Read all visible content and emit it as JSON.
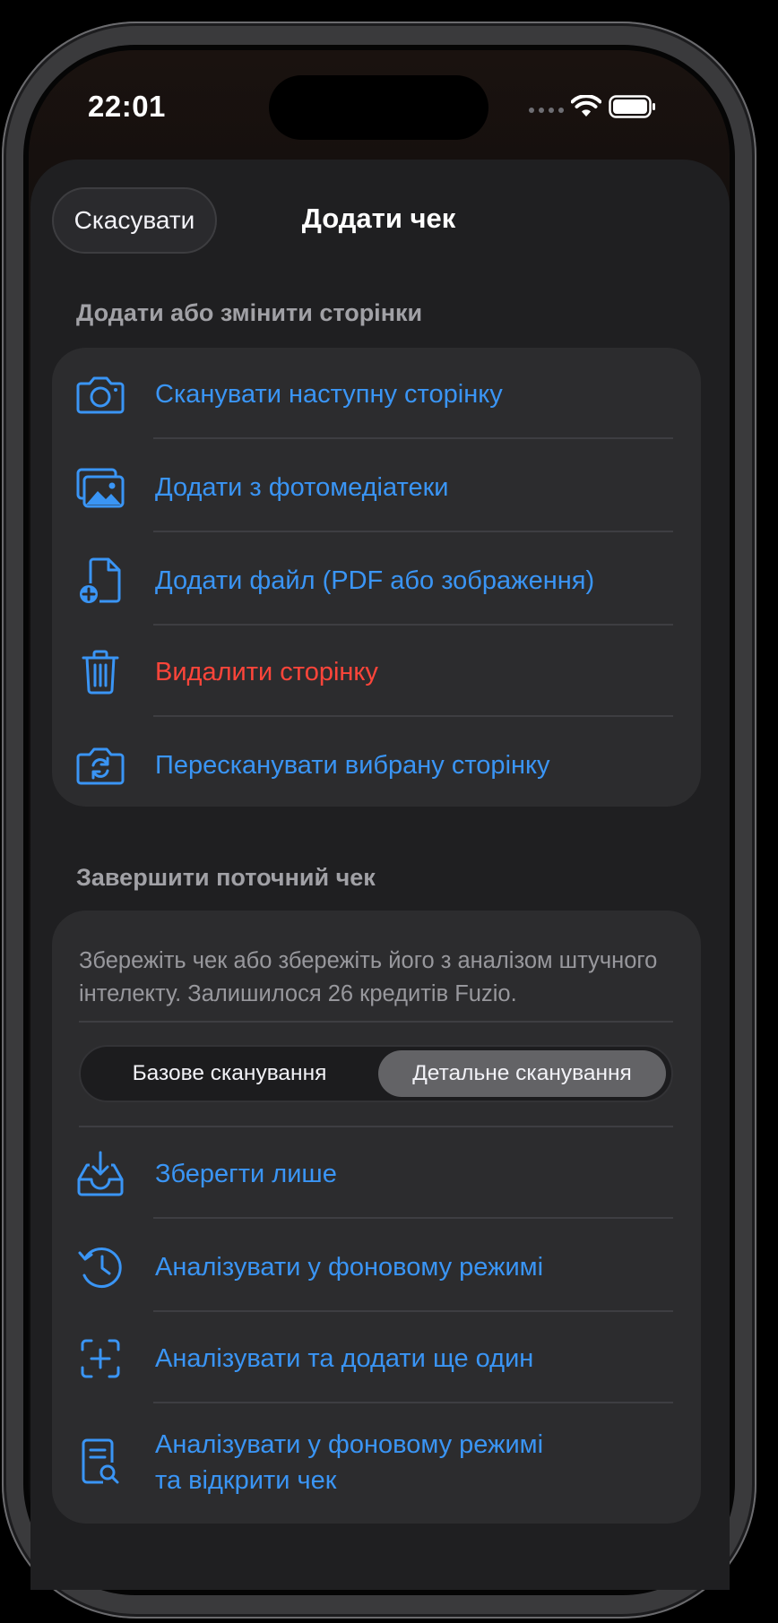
{
  "status_bar": {
    "time": "22:01"
  },
  "header": {
    "cancel_label": "Скасувати",
    "title": "Додати чек"
  },
  "pages_section": {
    "header": "Додати або змінити сторінки",
    "items": [
      {
        "label": "Сканувати наступну сторінку",
        "icon": "camera-icon"
      },
      {
        "label": "Додати з фотомедіатеки",
        "icon": "photo-library-icon"
      },
      {
        "label": "Додати файл (PDF або зображення)",
        "icon": "add-file-icon"
      },
      {
        "label": "Видалити сторінку",
        "icon": "trash-icon"
      },
      {
        "label": "Пересканувати вибрану сторінку",
        "icon": "camera-rotate-icon"
      }
    ]
  },
  "finish_section": {
    "header": "Завершити поточний чек",
    "description": "Збережіть чек або збережіть його з аналізом штучного інтелекту. Залишилося 26 кредитів Fuzio.",
    "segmented": {
      "options": [
        "Базове сканування",
        "Детальне сканування"
      ],
      "selected": "Детальне сканування"
    },
    "items": [
      {
        "label": "Зберегти лише",
        "icon": "tray-download-icon"
      },
      {
        "label": "Аналізувати у фоновому режимі",
        "icon": "clock-history-icon"
      },
      {
        "label": "Аналізувати та додати ще один",
        "icon": "scan-plus-icon"
      },
      {
        "label_line1": "Аналізувати у фоновому режимі",
        "label_line2": "та відкрити чек",
        "icon": "doc-search-icon"
      }
    ]
  },
  "colors": {
    "accent": "#3a95f5",
    "destructive": "#ff453a",
    "card": "#2c2c2e",
    "sheet": "#1f1f21"
  }
}
